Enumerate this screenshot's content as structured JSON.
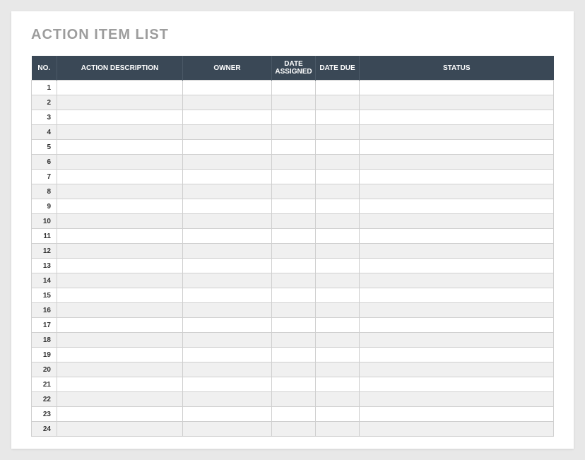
{
  "title": "ACTION ITEM LIST",
  "columns": {
    "no": "NO.",
    "description": "ACTION DESCRIPTION",
    "owner": "OWNER",
    "assigned": "DATE ASSIGNED",
    "due": "DATE DUE",
    "status": "STATUS"
  },
  "rows": [
    {
      "no": "1",
      "description": "",
      "owner": "",
      "assigned": "",
      "due": "",
      "status": ""
    },
    {
      "no": "2",
      "description": "",
      "owner": "",
      "assigned": "",
      "due": "",
      "status": ""
    },
    {
      "no": "3",
      "description": "",
      "owner": "",
      "assigned": "",
      "due": "",
      "status": ""
    },
    {
      "no": "4",
      "description": "",
      "owner": "",
      "assigned": "",
      "due": "",
      "status": ""
    },
    {
      "no": "5",
      "description": "",
      "owner": "",
      "assigned": "",
      "due": "",
      "status": ""
    },
    {
      "no": "6",
      "description": "",
      "owner": "",
      "assigned": "",
      "due": "",
      "status": ""
    },
    {
      "no": "7",
      "description": "",
      "owner": "",
      "assigned": "",
      "due": "",
      "status": ""
    },
    {
      "no": "8",
      "description": "",
      "owner": "",
      "assigned": "",
      "due": "",
      "status": ""
    },
    {
      "no": "9",
      "description": "",
      "owner": "",
      "assigned": "",
      "due": "",
      "status": ""
    },
    {
      "no": "10",
      "description": "",
      "owner": "",
      "assigned": "",
      "due": "",
      "status": ""
    },
    {
      "no": "11",
      "description": "",
      "owner": "",
      "assigned": "",
      "due": "",
      "status": ""
    },
    {
      "no": "12",
      "description": "",
      "owner": "",
      "assigned": "",
      "due": "",
      "status": ""
    },
    {
      "no": "13",
      "description": "",
      "owner": "",
      "assigned": "",
      "due": "",
      "status": ""
    },
    {
      "no": "14",
      "description": "",
      "owner": "",
      "assigned": "",
      "due": "",
      "status": ""
    },
    {
      "no": "15",
      "description": "",
      "owner": "",
      "assigned": "",
      "due": "",
      "status": ""
    },
    {
      "no": "16",
      "description": "",
      "owner": "",
      "assigned": "",
      "due": "",
      "status": ""
    },
    {
      "no": "17",
      "description": "",
      "owner": "",
      "assigned": "",
      "due": "",
      "status": ""
    },
    {
      "no": "18",
      "description": "",
      "owner": "",
      "assigned": "",
      "due": "",
      "status": ""
    },
    {
      "no": "19",
      "description": "",
      "owner": "",
      "assigned": "",
      "due": "",
      "status": ""
    },
    {
      "no": "20",
      "description": "",
      "owner": "",
      "assigned": "",
      "due": "",
      "status": ""
    },
    {
      "no": "21",
      "description": "",
      "owner": "",
      "assigned": "",
      "due": "",
      "status": ""
    },
    {
      "no": "22",
      "description": "",
      "owner": "",
      "assigned": "",
      "due": "",
      "status": ""
    },
    {
      "no": "23",
      "description": "",
      "owner": "",
      "assigned": "",
      "due": "",
      "status": ""
    },
    {
      "no": "24",
      "description": "",
      "owner": "",
      "assigned": "",
      "due": "",
      "status": ""
    }
  ]
}
